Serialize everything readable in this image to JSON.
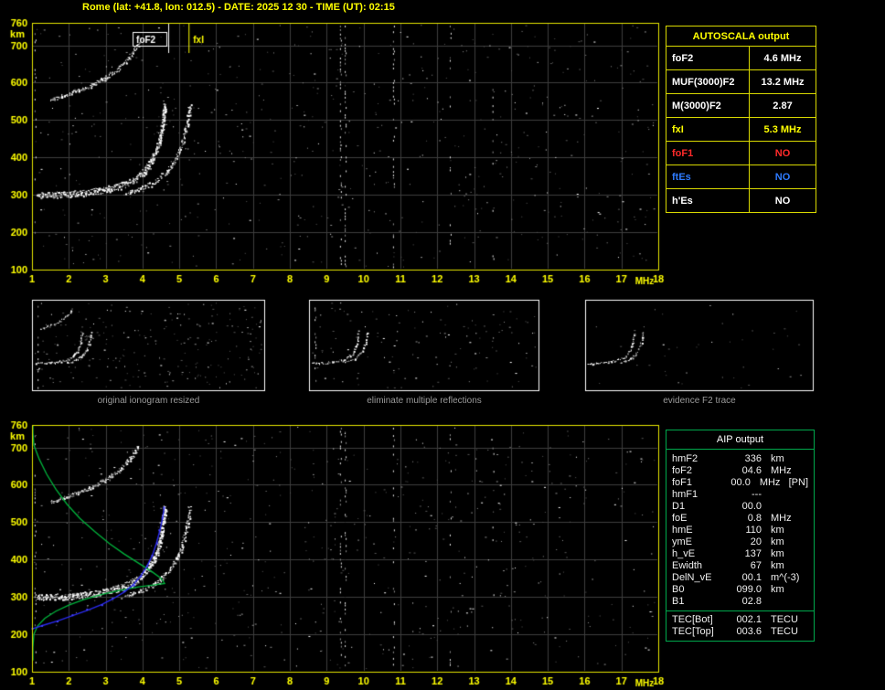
{
  "title": "Rome (lat: +41.8, lon: 012.5) - DATE: 2025 12 30 - TIME (UT): 02:15",
  "colors": {
    "background": "#000000",
    "axis_yellow": "#ffff00",
    "plot_border_yellow": "#e6e600",
    "grid_gray": "#3e3e3e",
    "trace_white": "#ffffff",
    "profile_green": "#00b43c",
    "restored_blue": "#2a2aee",
    "aip_border_green": "#00a84c",
    "caption_gray": "#9a9a9a",
    "value_red": "#ff2a2a",
    "value_blue": "#2e7bff"
  },
  "autoscala": {
    "header": "AUTOSCALA output",
    "rows": [
      {
        "label": "foF2",
        "value": "4.6 MHz",
        "color": "white"
      },
      {
        "label": "MUF(3000)F2",
        "value": "13.2 MHz",
        "color": "white"
      },
      {
        "label": "M(3000)F2",
        "value": "2.87",
        "color": "white"
      },
      {
        "label": "fxI",
        "value": "5.3 MHz",
        "color": "yellow"
      },
      {
        "label": "foF1",
        "value": "NO",
        "color": "red"
      },
      {
        "label": "ftEs",
        "value": "NO",
        "color": "blue"
      },
      {
        "label": "h'Es",
        "value": "NO",
        "color": "white"
      }
    ]
  },
  "aip": {
    "header": "AIP output",
    "rows": [
      {
        "name": "hmF2",
        "value": "336",
        "unit": "km"
      },
      {
        "name": "foF2",
        "value": "04.6",
        "unit": "MHz"
      },
      {
        "name": "foF1",
        "value": "00.0",
        "unit": "MHz   [PN]"
      },
      {
        "name": "hmF1",
        "value": "---",
        "unit": ""
      },
      {
        "name": "D1",
        "value": "00.0",
        "unit": ""
      },
      {
        "name": "foE",
        "value": "0.8",
        "unit": "MHz"
      },
      {
        "name": "hmE",
        "value": "110",
        "unit": "km"
      },
      {
        "name": "ymE",
        "value": "20",
        "unit": "km"
      },
      {
        "name": "h_vE",
        "value": "137",
        "unit": "km"
      },
      {
        "name": "Ewidth",
        "value": "67",
        "unit": "km"
      },
      {
        "name": "DelN_vE",
        "value": "00.1",
        "unit": "m^(-3)"
      },
      {
        "name": "B0",
        "value": "099.0",
        "unit": "km"
      },
      {
        "name": "B1",
        "value": "02.8",
        "unit": ""
      }
    ],
    "tec_rows": [
      {
        "name": "TEC[Bot]",
        "value": "002.1",
        "unit": "TECU"
      },
      {
        "name": "TEC[Top]",
        "value": "003.6",
        "unit": "TECU"
      }
    ]
  },
  "thumbnails": [
    {
      "caption": "original ionogram resized"
    },
    {
      "caption": "eliminate multiple reflections"
    },
    {
      "caption": "evidence F2 trace"
    }
  ],
  "chart_data": {
    "type": "scatter",
    "title": "Rome ionogram with AUTOSCALA scaling (top) and AIP inverted profile (bottom)",
    "xlabel": "MHz",
    "ylabel": "km",
    "xlim": [
      1,
      18
    ],
    "ylim": [
      100,
      760
    ],
    "grid": true,
    "x_ticks": [
      1,
      2,
      3,
      4,
      5,
      6,
      7,
      8,
      9,
      10,
      11,
      12,
      13,
      14,
      15,
      16,
      17,
      18
    ],
    "y_tick_labels": [
      "760",
      "700",
      "600",
      "500",
      "400",
      "300",
      "200",
      "100"
    ],
    "y_tick_values": [
      760,
      700,
      600,
      500,
      400,
      300,
      200,
      100
    ],
    "axis_unit_x": "MHz",
    "axis_unit_y": "km",
    "annotations": {
      "foF2_label": "foF2",
      "foF2_MHz": 4.6,
      "fxI_label": "fxI",
      "fxI_MHz": 5.3
    },
    "series": {
      "o_trace": [
        [
          1.15,
          300
        ],
        [
          1.6,
          301
        ],
        [
          2.0,
          302
        ],
        [
          2.6,
          308
        ],
        [
          3.0,
          315
        ],
        [
          3.4,
          325
        ],
        [
          3.7,
          338
        ],
        [
          3.9,
          352
        ],
        [
          4.1,
          370
        ],
        [
          4.25,
          392
        ],
        [
          4.38,
          420
        ],
        [
          4.47,
          450
        ],
        [
          4.53,
          480
        ],
        [
          4.57,
          515
        ],
        [
          4.6,
          545
        ]
      ],
      "x_trace": [
        [
          3.55,
          305
        ],
        [
          3.9,
          315
        ],
        [
          4.2,
          328
        ],
        [
          4.45,
          345
        ],
        [
          4.65,
          365
        ],
        [
          4.85,
          390
        ],
        [
          5.0,
          418
        ],
        [
          5.1,
          448
        ],
        [
          5.18,
          480
        ],
        [
          5.24,
          512
        ],
        [
          5.28,
          545
        ]
      ],
      "second_hop": [
        [
          1.5,
          555
        ],
        [
          1.9,
          568
        ],
        [
          2.3,
          582
        ],
        [
          2.7,
          598
        ],
        [
          3.0,
          615
        ],
        [
          3.3,
          635
        ],
        [
          3.55,
          658
        ],
        [
          3.75,
          682
        ],
        [
          3.9,
          706
        ]
      ]
    },
    "overlays_bottom": {
      "profile_green": [
        [
          0.98,
          130
        ],
        [
          1.0,
          165
        ],
        [
          1.05,
          200
        ],
        [
          1.15,
          222
        ],
        [
          1.35,
          243
        ],
        [
          1.65,
          262
        ],
        [
          2.0,
          278
        ],
        [
          2.4,
          293
        ],
        [
          2.9,
          307
        ],
        [
          3.4,
          318
        ],
        [
          3.9,
          327
        ],
        [
          4.3,
          332
        ],
        [
          4.6,
          336
        ],
        [
          4.5,
          350
        ],
        [
          4.25,
          368
        ],
        [
          3.9,
          390
        ],
        [
          3.5,
          415
        ],
        [
          3.1,
          443
        ],
        [
          2.7,
          475
        ],
        [
          2.3,
          510
        ],
        [
          1.95,
          548
        ],
        [
          1.65,
          588
        ],
        [
          1.4,
          628
        ],
        [
          1.2,
          668
        ],
        [
          1.05,
          706
        ],
        [
          0.97,
          740
        ],
        [
          0.95,
          760
        ]
      ],
      "restored_blue": [
        [
          1.0,
          215
        ],
        [
          1.3,
          224
        ],
        [
          1.7,
          236
        ],
        [
          2.1,
          250
        ],
        [
          2.5,
          264
        ],
        [
          2.9,
          280
        ],
        [
          3.2,
          295
        ],
        [
          3.5,
          313
        ],
        [
          3.75,
          333
        ],
        [
          3.95,
          356
        ],
        [
          4.12,
          382
        ],
        [
          4.27,
          412
        ],
        [
          4.38,
          444
        ],
        [
          4.47,
          477
        ],
        [
          4.54,
          510
        ],
        [
          4.59,
          540
        ]
      ]
    },
    "rfi_columns_MHz": [
      9.36,
      9.49,
      10.8,
      12.34,
      13.5
    ]
  }
}
